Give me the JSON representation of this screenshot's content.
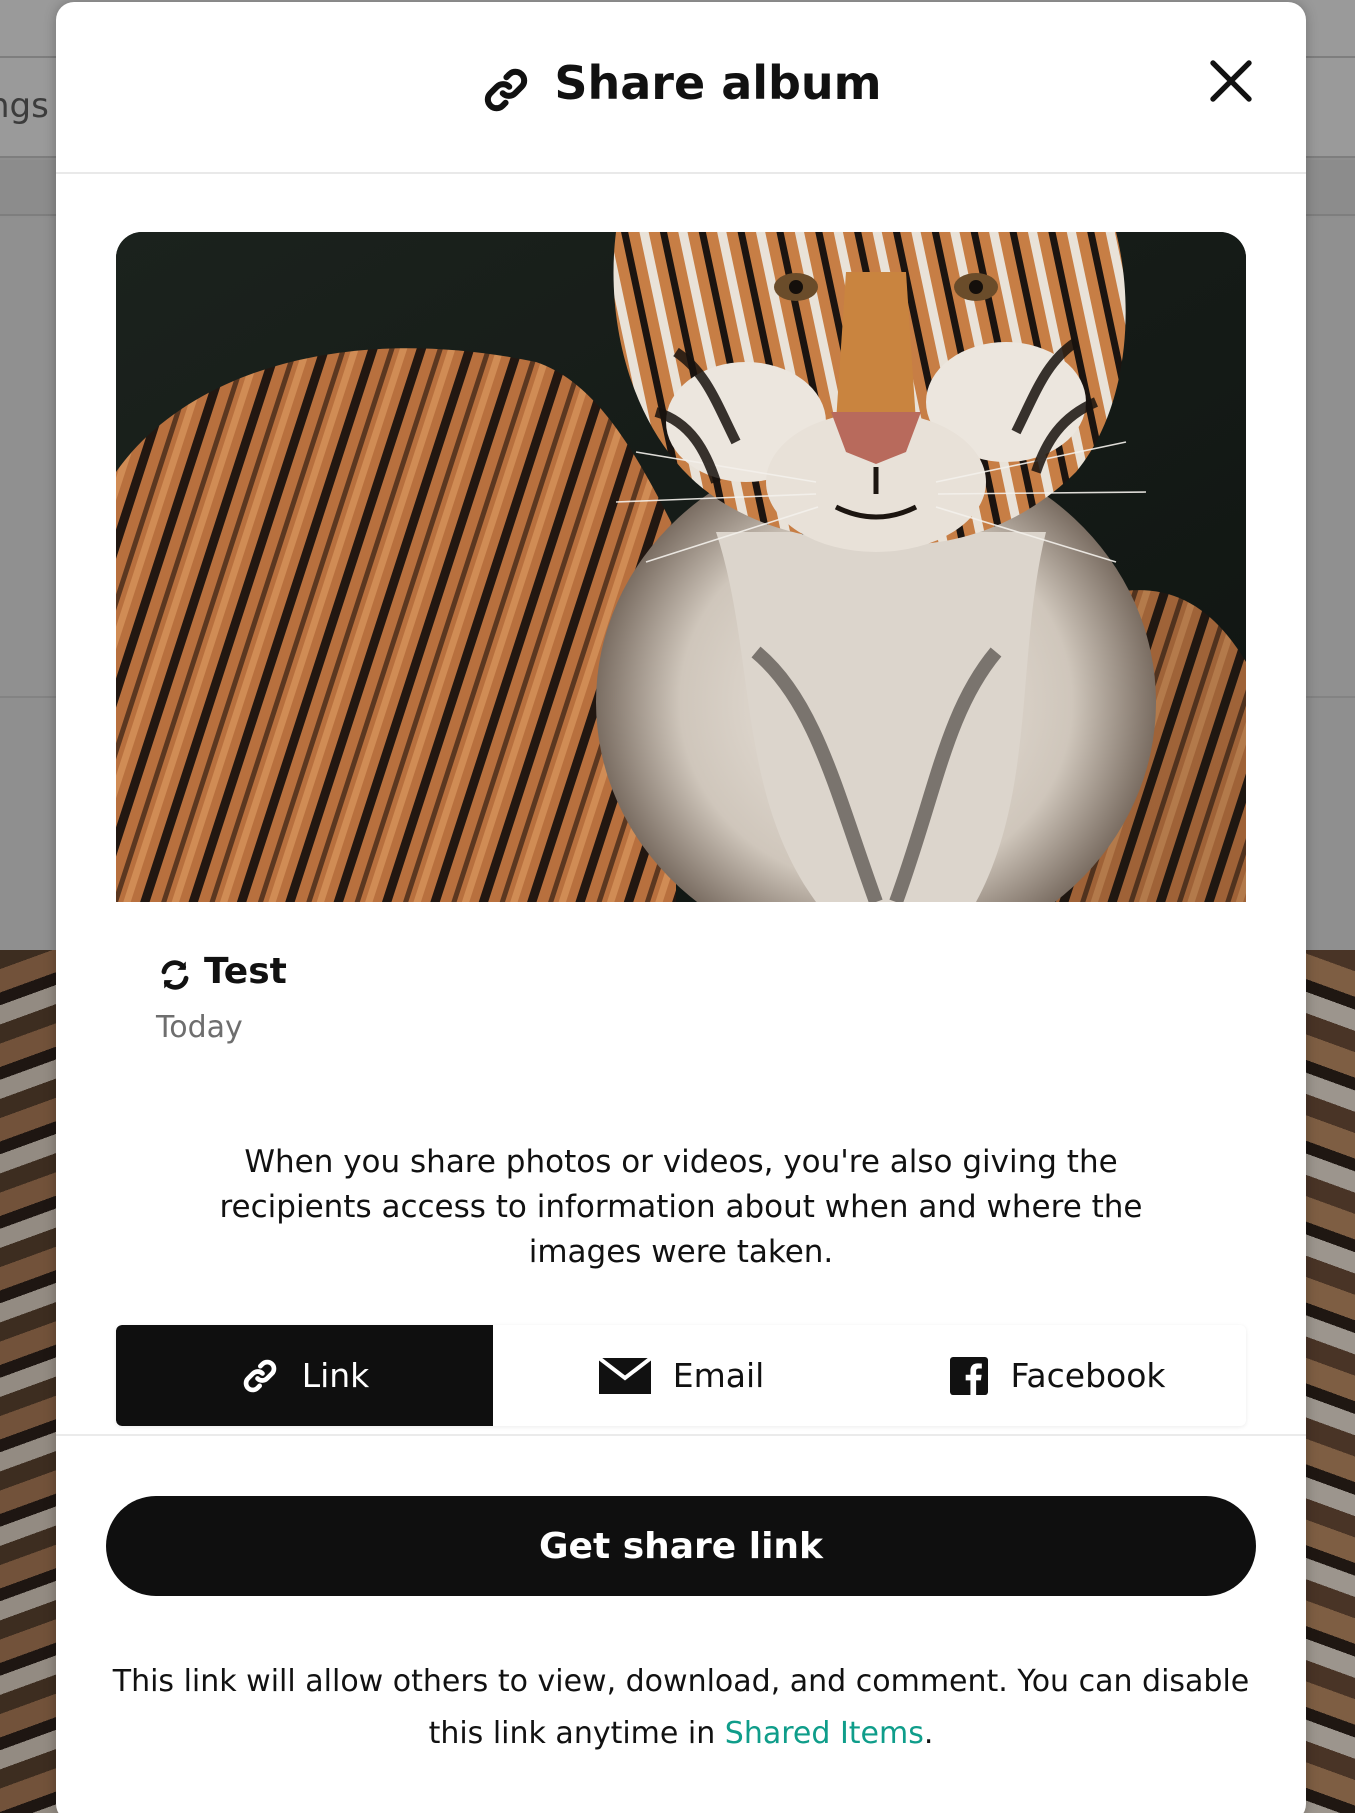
{
  "background": {
    "nav_partial_text": "ngs"
  },
  "modal": {
    "title": "Share album",
    "title_icon": "link-icon",
    "close_icon": "close-icon"
  },
  "album": {
    "name": "Test",
    "name_icon": "sync-icon",
    "date": "Today",
    "cover_alt": "tiger photo"
  },
  "privacy_note": "When you share photos or videos, you're also giving the recipients access to information about when and where the images were taken.",
  "share_methods": {
    "selected": "Link",
    "tabs": [
      {
        "label": "Link",
        "icon": "link-icon"
      },
      {
        "label": "Email",
        "icon": "envelope-icon"
      },
      {
        "label": "Facebook",
        "icon": "facebook-icon"
      }
    ]
  },
  "primary_action": {
    "label": "Get share link"
  },
  "footer": {
    "text_before": "This link will allow others to view, download, and comment. You can disable this link anytime in ",
    "link_text": "Shared Items",
    "text_after": "."
  },
  "colors": {
    "accent_link": "#0f9d8a",
    "primary_button": "#0f0f0f",
    "muted_text": "#6e6e6e"
  }
}
